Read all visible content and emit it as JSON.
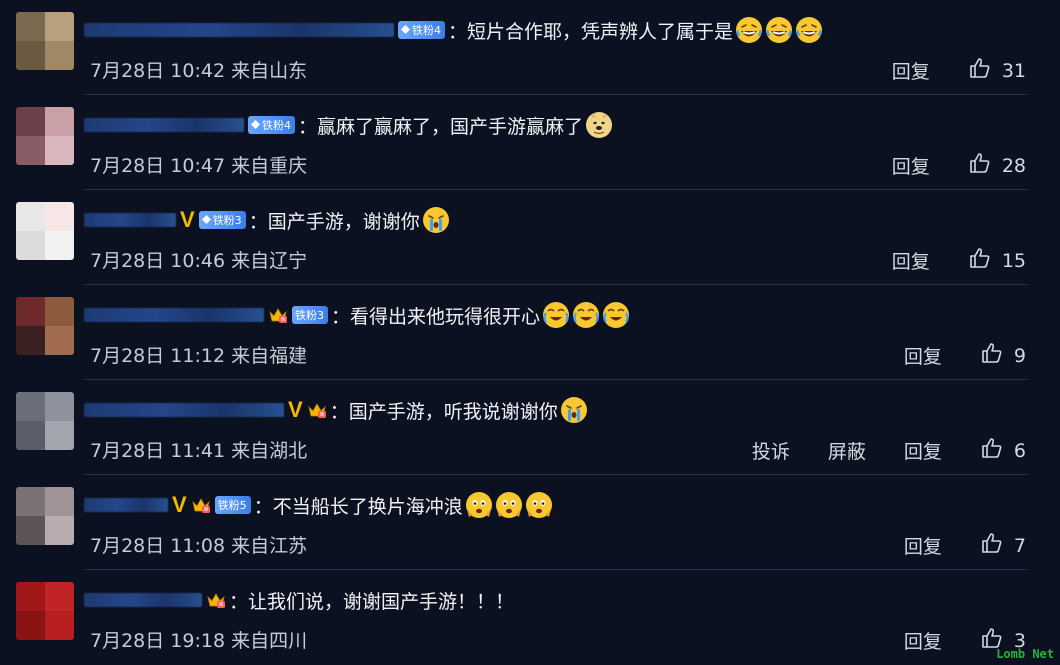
{
  "comments": [
    {
      "text": "短片合作耶，凭声辨人了属于是",
      "emoji": [
        "laugh",
        "laugh",
        "laugh"
      ],
      "time": "7月28日 10:42 来自山东",
      "reply": "回复",
      "likes": "31",
      "v": false,
      "crown": false,
      "fan": "铁粉4",
      "fanStyle": "gem",
      "nameW": 310,
      "avatar": [
        "#7a6a50",
        "#b8a07c",
        "#6b5a42",
        "#a08866"
      ]
    },
    {
      "text": "赢麻了赢麻了，国产手游赢麻了",
      "emoji": [
        "doge"
      ],
      "time": "7月28日 10:47 来自重庆",
      "reply": "回复",
      "likes": "28",
      "v": false,
      "crown": false,
      "fan": "铁粉4",
      "fanStyle": "gem",
      "nameW": 160,
      "avatar": [
        "#6b4048",
        "#c9a0a6",
        "#8a5d66",
        "#d8b8be"
      ]
    },
    {
      "text": "国产手游，谢谢你",
      "emoji": [
        "cry"
      ],
      "time": "7月28日 10:46 来自辽宁",
      "reply": "回复",
      "likes": "15",
      "v": true,
      "crown": false,
      "fan": "铁粉3",
      "fanStyle": "gem",
      "nameW": 92,
      "avatar": [
        "#e8e8e8",
        "#f6e6e6",
        "#dcdcdc",
        "#f2f2f2"
      ]
    },
    {
      "text": "看得出来他玩得很开心",
      "emoji": [
        "tears",
        "tears",
        "tears"
      ],
      "time": "7月28日 11:12 来自福建",
      "reply": "回复",
      "likes": "9",
      "v": false,
      "crown": true,
      "fan": "铁粉3",
      "fanStyle": "crown",
      "nameW": 180,
      "avatar": [
        "#6e2a2a",
        "#8c5a3c",
        "#3a2020",
        "#a06b4e"
      ]
    },
    {
      "text": "国产手游，听我说谢谢你",
      "emoji": [
        "cry"
      ],
      "time": "7月28日 11:41 来自湖北",
      "report": "投诉",
      "block": "屏蔽",
      "reply": "回复",
      "likes": "6",
      "v": true,
      "crown": true,
      "fan": "",
      "fanStyle": "crown",
      "nameW": 200,
      "avatar": [
        "#6a6e78",
        "#8e929c",
        "#5a5e68",
        "#a2a6ae"
      ]
    },
    {
      "text": "不当船长了换片海冲浪",
      "emoji": [
        "cry2",
        "cry2",
        "cry2"
      ],
      "time": "7月28日 11:08 来自江苏",
      "reply": "回复",
      "likes": "7",
      "v": true,
      "crown": true,
      "fan": "铁粉5",
      "fanStyle": "crown",
      "nameW": 84,
      "avatar": [
        "#7c7274",
        "#a09496",
        "#5e5456",
        "#b8acae"
      ]
    },
    {
      "text": "让我们说，谢谢国产手游！！！",
      "emoji": [],
      "time": "7月28日 19:18 来自四川",
      "reply": "回复",
      "likes": "3",
      "v": false,
      "crown": true,
      "fan": "",
      "fanStyle": "crown",
      "nameW": 118,
      "avatar": [
        "#a01818",
        "#c02424",
        "#8a1414",
        "#b81e1e"
      ]
    }
  ],
  "colors": {
    "background": "#0b1120",
    "fan_badge": "#3c7ee8",
    "vip": "#f5b800"
  },
  "watermark": "Lomb Net"
}
